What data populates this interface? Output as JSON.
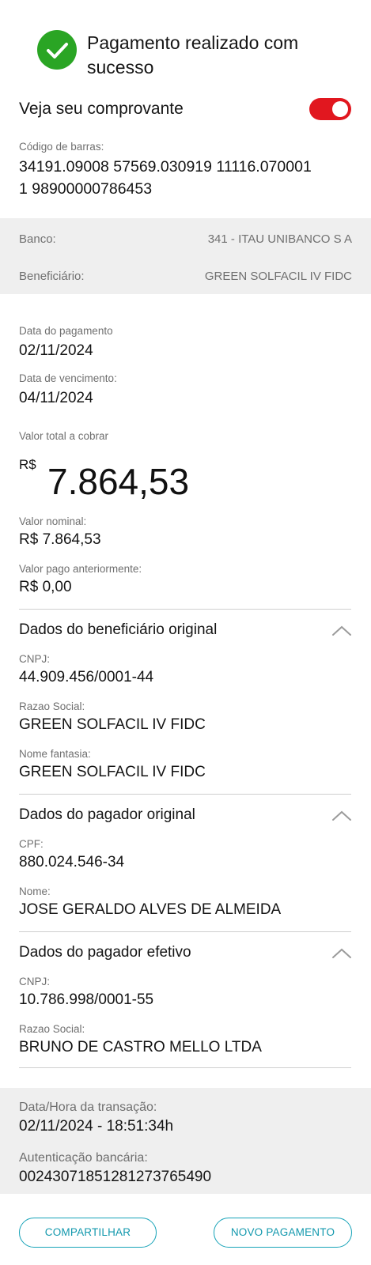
{
  "header": {
    "title": "Pagamento realizado com sucesso",
    "receipt_label": "Veja seu comprovante",
    "receipt_toggle_on": true,
    "accent_color": "#e1171f",
    "success_color": "#2aa524"
  },
  "barcode": {
    "label": "Código de barras:",
    "line1": "34191.09008 57569.030919 11116.070001",
    "line2": "1 98900000786453"
  },
  "bank": {
    "bank_label": "Banco:",
    "bank_value": "341 - ITAU UNIBANCO S A",
    "beneficiary_label": "Beneficiário:",
    "beneficiary_value": "GREEN SOLFACIL IV FIDC"
  },
  "payment": {
    "payment_date_label": "Data do pagamento",
    "payment_date": "02/11/2024",
    "due_date_label": "Data de vencimento:",
    "due_date": "04/11/2024",
    "total_label": "Valor total a cobrar",
    "currency": "R$",
    "total_value": "7.864,53",
    "nominal_label": "Valor nominal:",
    "nominal_value": "R$ 7.864,53",
    "prev_paid_label": "Valor pago anteriormente:",
    "prev_paid_value": "R$ 0,00"
  },
  "original_beneficiary": {
    "title": "Dados do beneficiário original",
    "cnpj_label": "CNPJ:",
    "cnpj": "44.909.456/0001-44",
    "razao_label": "Razao Social:",
    "razao": "GREEN SOLFACIL IV FIDC",
    "fantasia_label": "Nome fantasia:",
    "fantasia": "GREEN SOLFACIL IV FIDC"
  },
  "original_payer": {
    "title": "Dados do pagador original",
    "cpf_label": "CPF:",
    "cpf": "880.024.546-34",
    "name_label": "Nome:",
    "name": "JOSE GERALDO ALVES DE ALMEIDA"
  },
  "effective_payer": {
    "title": "Dados do pagador efetivo",
    "cnpj_label": "CNPJ:",
    "cnpj": "10.786.998/0001-55",
    "razao_label": "Razao Social:",
    "razao": "BRUNO DE CASTRO MELLO LTDA"
  },
  "transaction": {
    "datetime_label": "Data/Hora da transação:",
    "datetime": "02/11/2024 - 18:51:34h",
    "auth_label": "Autenticação bancária:",
    "auth": "00243071851281273765490"
  },
  "actions": {
    "share_label": "COMPARTILHAR",
    "new_payment_label": "NOVO PAGAMENTO"
  }
}
